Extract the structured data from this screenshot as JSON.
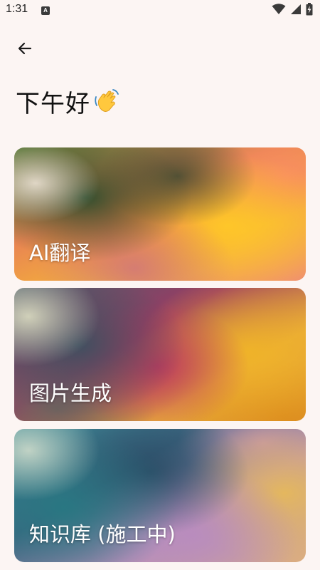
{
  "status_bar": {
    "time": "1:31",
    "notification_badge": "A",
    "icons": [
      "wifi-icon",
      "cell-signal-icon",
      "battery-charging-icon"
    ]
  },
  "header": {
    "back_icon": "arrow-left-icon",
    "greeting": "下午好",
    "greeting_emoji": "waving-hand-icon"
  },
  "cards": [
    {
      "label": "AI翻译"
    },
    {
      "label": "图片生成"
    },
    {
      "label": "知识库 (施工中)"
    }
  ]
}
